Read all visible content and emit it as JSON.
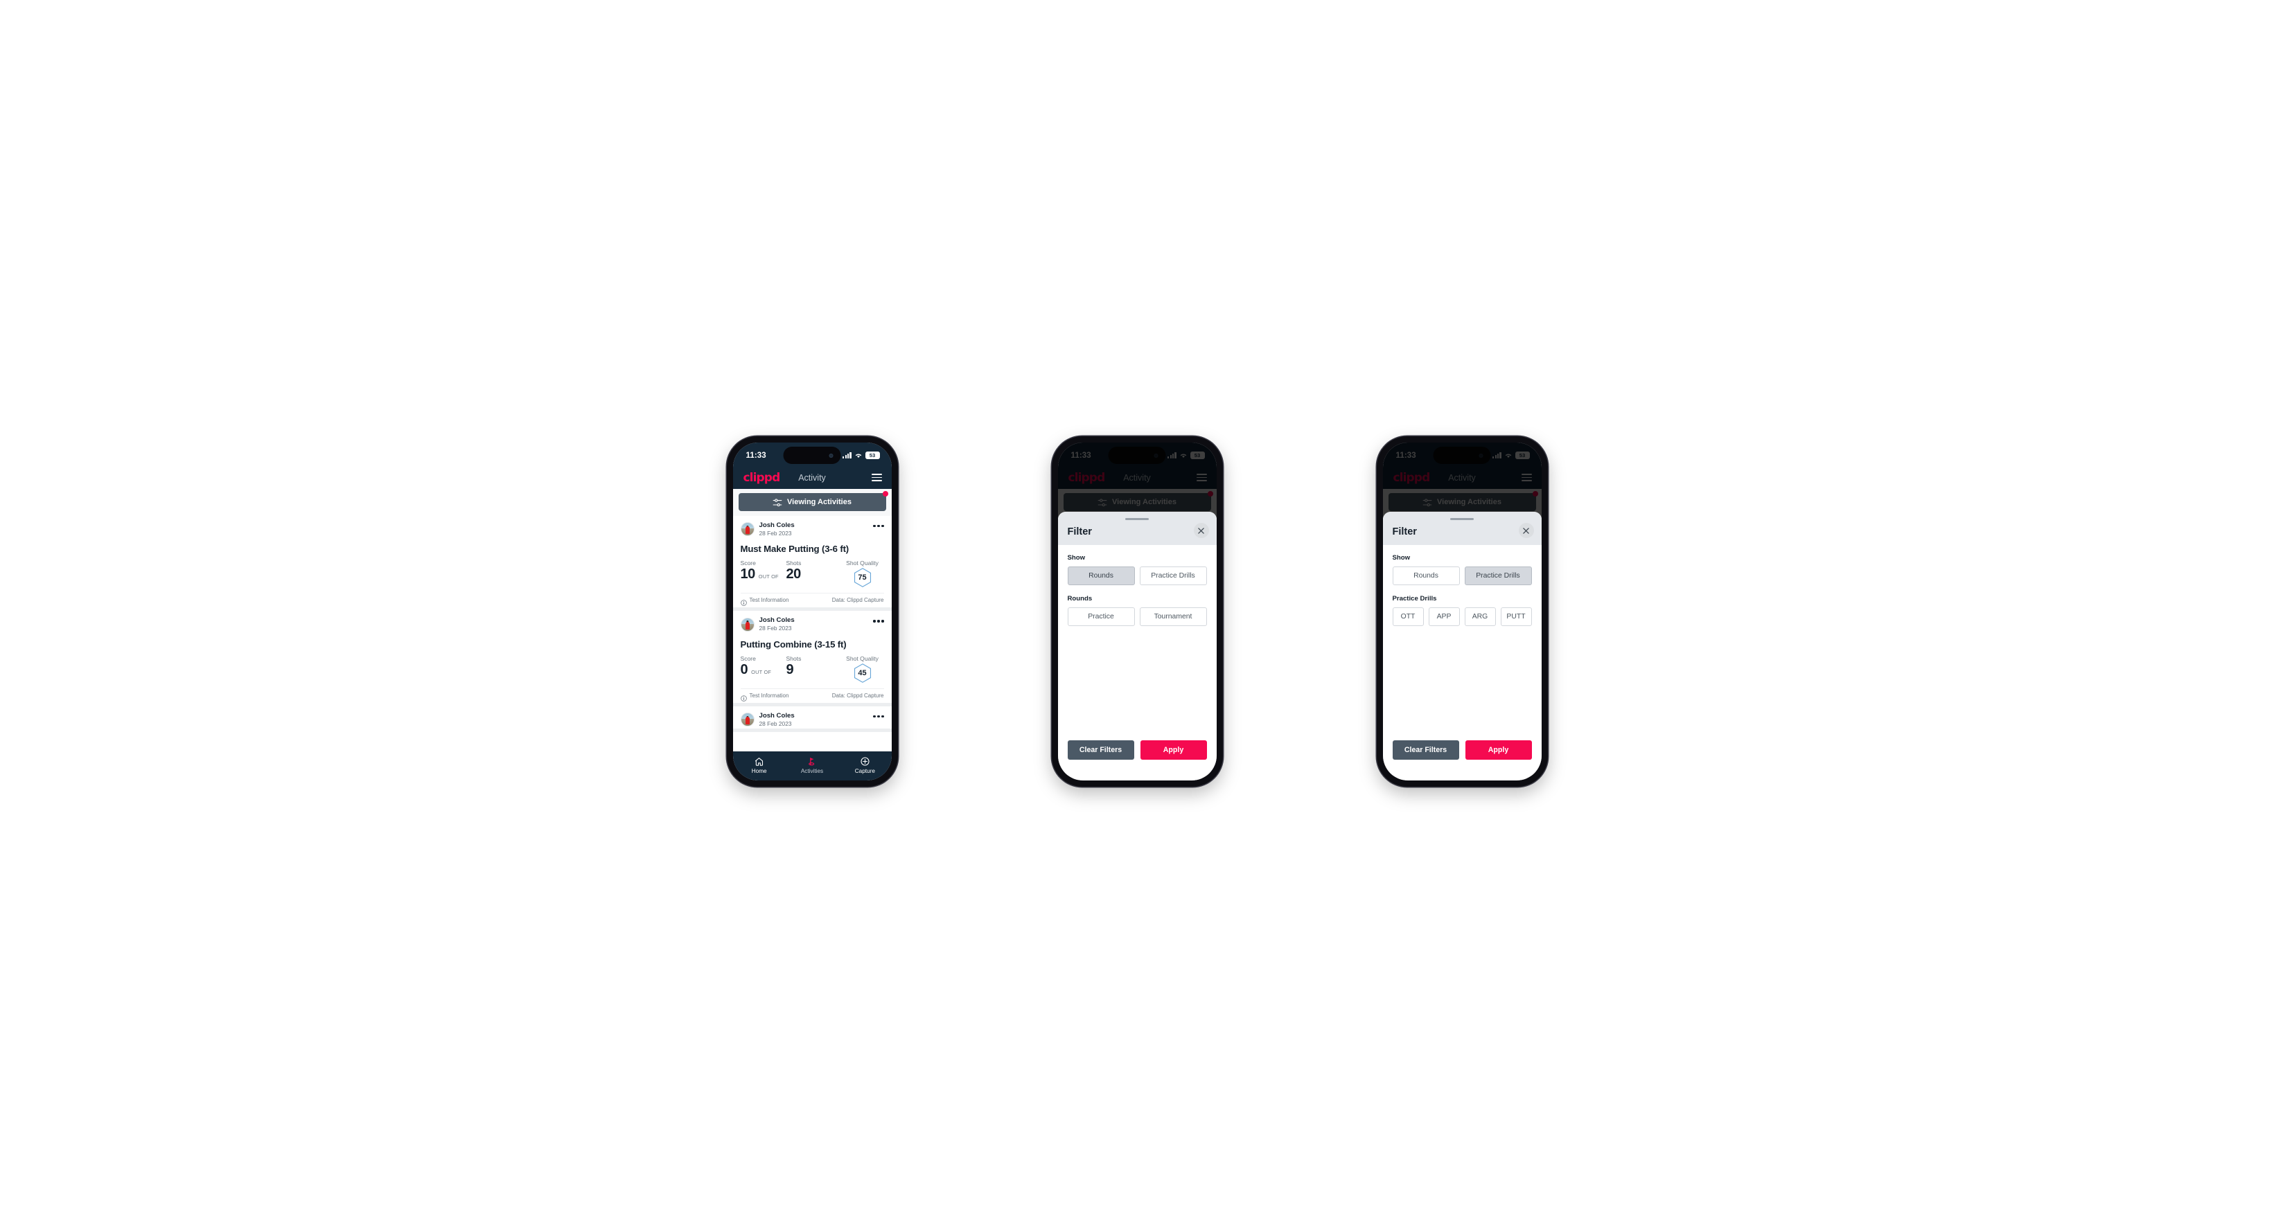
{
  "status_bar": {
    "time": "11:33",
    "battery": "53",
    "signal_icon": "signal-bars-icon",
    "wifi_icon": "wifi-icon"
  },
  "app_bar": {
    "brand": "clippd",
    "title": "Activity",
    "menu_icon": "hamburger-menu-icon"
  },
  "filter_pill": {
    "label": "Viewing Activities",
    "icon": "sliders-filter-icon",
    "has_notification_dot": true
  },
  "feed": {
    "cards": [
      {
        "author": "Josh Coles",
        "date": "28 Feb 2023",
        "title": "Must Make Putting (3-6 ft)",
        "score_label": "Score",
        "score_value": "10",
        "out_of_label": "OUT OF",
        "shots_label": "Shots",
        "shots_value": "20",
        "quality_label": "Shot Quality",
        "quality_value": "75",
        "footer_left": "Test Information",
        "footer_right": "Data: Clippd Capture"
      },
      {
        "author": "Josh Coles",
        "date": "28 Feb 2023",
        "title": "Putting Combine (3-15 ft)",
        "score_label": "Score",
        "score_value": "0",
        "out_of_label": "OUT OF",
        "shots_label": "Shots",
        "shots_value": "9",
        "quality_label": "Shot Quality",
        "quality_value": "45",
        "footer_left": "Test Information",
        "footer_right": "Data: Clippd Capture"
      },
      {
        "author": "Josh Coles",
        "date": "28 Feb 2023"
      }
    ]
  },
  "bottom_nav": {
    "items": [
      {
        "label": "Home",
        "icon": "home-icon",
        "active": false
      },
      {
        "label": "Activities",
        "icon": "golf-flag-icon",
        "active": true
      },
      {
        "label": "Capture",
        "icon": "plus-circle-icon",
        "active": false
      }
    ]
  },
  "filter_sheet": {
    "title": "Filter",
    "close_icon": "close-x-icon",
    "show_label": "Show",
    "show_options": [
      "Rounds",
      "Practice Drills"
    ],
    "rounds_label": "Rounds",
    "rounds_options": [
      "Practice",
      "Tournament"
    ],
    "drills_label": "Practice Drills",
    "drills_options": [
      "OTT",
      "APP",
      "ARG",
      "PUTT"
    ],
    "clear_label": "Clear Filters",
    "apply_label": "Apply"
  },
  "states": {
    "phone2_selected_show": "Rounds",
    "phone3_selected_show": "Practice Drills"
  },
  "colors": {
    "header_navy": "#15293a",
    "accent_pink": "#f50a50",
    "slate": "#4b5966",
    "hex_blue": "#6aa7d8",
    "selected_grey": "#d4d8de"
  }
}
